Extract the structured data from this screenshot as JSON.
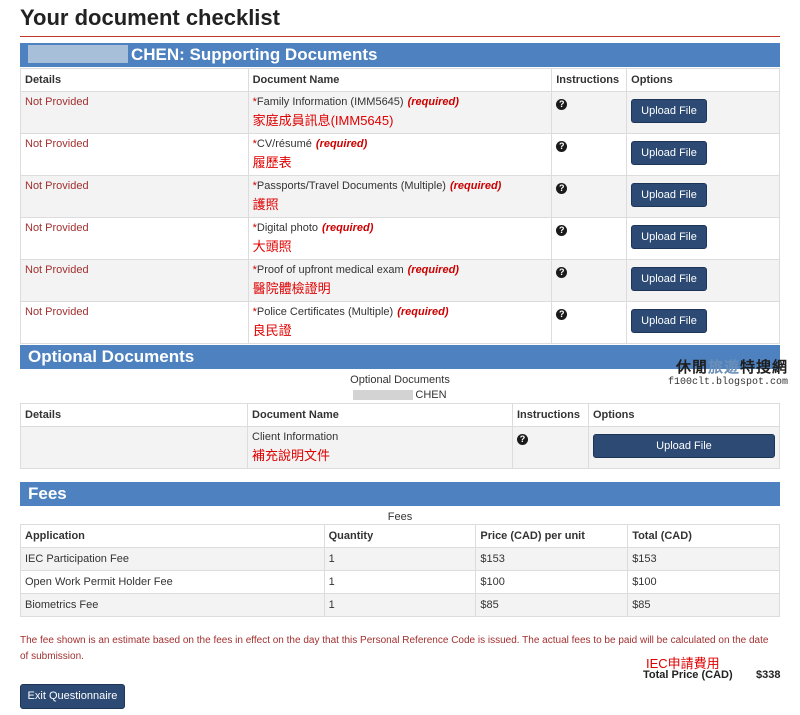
{
  "page": {
    "title": "Your document checklist"
  },
  "supporting": {
    "header_suffix": "CHEN: Supporting Documents",
    "columns": [
      "Details",
      "Document Name",
      "Instructions",
      "Options"
    ],
    "rows": [
      {
        "status": "Not Provided",
        "name": "Family Information (IMM5645)",
        "required": "(required)",
        "note_zh": "家庭成員訊息(IMM5645)",
        "upload": "Upload File"
      },
      {
        "status": "Not Provided",
        "name": "CV/résumé",
        "required": "(required)",
        "note_zh": "履歷表",
        "upload": "Upload File"
      },
      {
        "status": "Not Provided",
        "name": "Passports/Travel Documents (Multiple)",
        "required": "(required)",
        "note_zh": "護照",
        "upload": "Upload File"
      },
      {
        "status": "Not Provided",
        "name": "Digital photo",
        "required": "(required)",
        "note_zh": "大頭照",
        "upload": "Upload File"
      },
      {
        "status": "Not Provided",
        "name": "Proof of upfront medical exam",
        "required": "(required)",
        "note_zh": "醫院體檢證明",
        "upload": "Upload File"
      },
      {
        "status": "Not Provided",
        "name": "Police Certificates (Multiple)",
        "required": "(required)",
        "note_zh": "良民證",
        "upload": "Upload File"
      }
    ]
  },
  "optional": {
    "header": "Optional Documents",
    "caption": "Optional Documents",
    "caption_name": "CHEN",
    "columns": [
      "Details",
      "Document Name",
      "Instructions",
      "Options"
    ],
    "rows": [
      {
        "status": "",
        "name": "Client Information",
        "note_zh": "補充說明文件",
        "upload": "Upload File"
      }
    ]
  },
  "watermark": {
    "title_dark_1": "休閒",
    "title_light": "旅遊",
    "title_dark_2": "特搜網",
    "url": "f100clt.blogspot.com"
  },
  "fees": {
    "header": "Fees",
    "caption": "Fees",
    "columns": [
      "Application",
      "Quantity",
      "Price (CAD) per unit",
      "Total (CAD)"
    ],
    "rows": [
      {
        "application": "IEC Participation Fee",
        "quantity": "1",
        "price": "$153",
        "total": "$153"
      },
      {
        "application": "Open Work Permit Holder Fee",
        "quantity": "1",
        "price": "$100",
        "total": "$100"
      },
      {
        "application": "Biometrics Fee",
        "quantity": "1",
        "price": "$85",
        "total": "$85"
      }
    ],
    "note": "The fee shown is an estimate based on the fees in effect on the day that this Personal Reference Code is issued. The actual fees to be paid will be calculated on the date of submission.",
    "iec_label_zh": "IEC申請費用",
    "total_label": "Total Price (CAD)",
    "total_value": "$338"
  },
  "actions": {
    "exit_label": "Exit Questionnaire"
  },
  "icons": {
    "help": "question-circle-icon"
  },
  "colors": {
    "section_header": "#4d81bf",
    "button": "#2c4a73",
    "required": "#cc0000",
    "status": "#a33030",
    "chinese_note": "#e00000"
  }
}
